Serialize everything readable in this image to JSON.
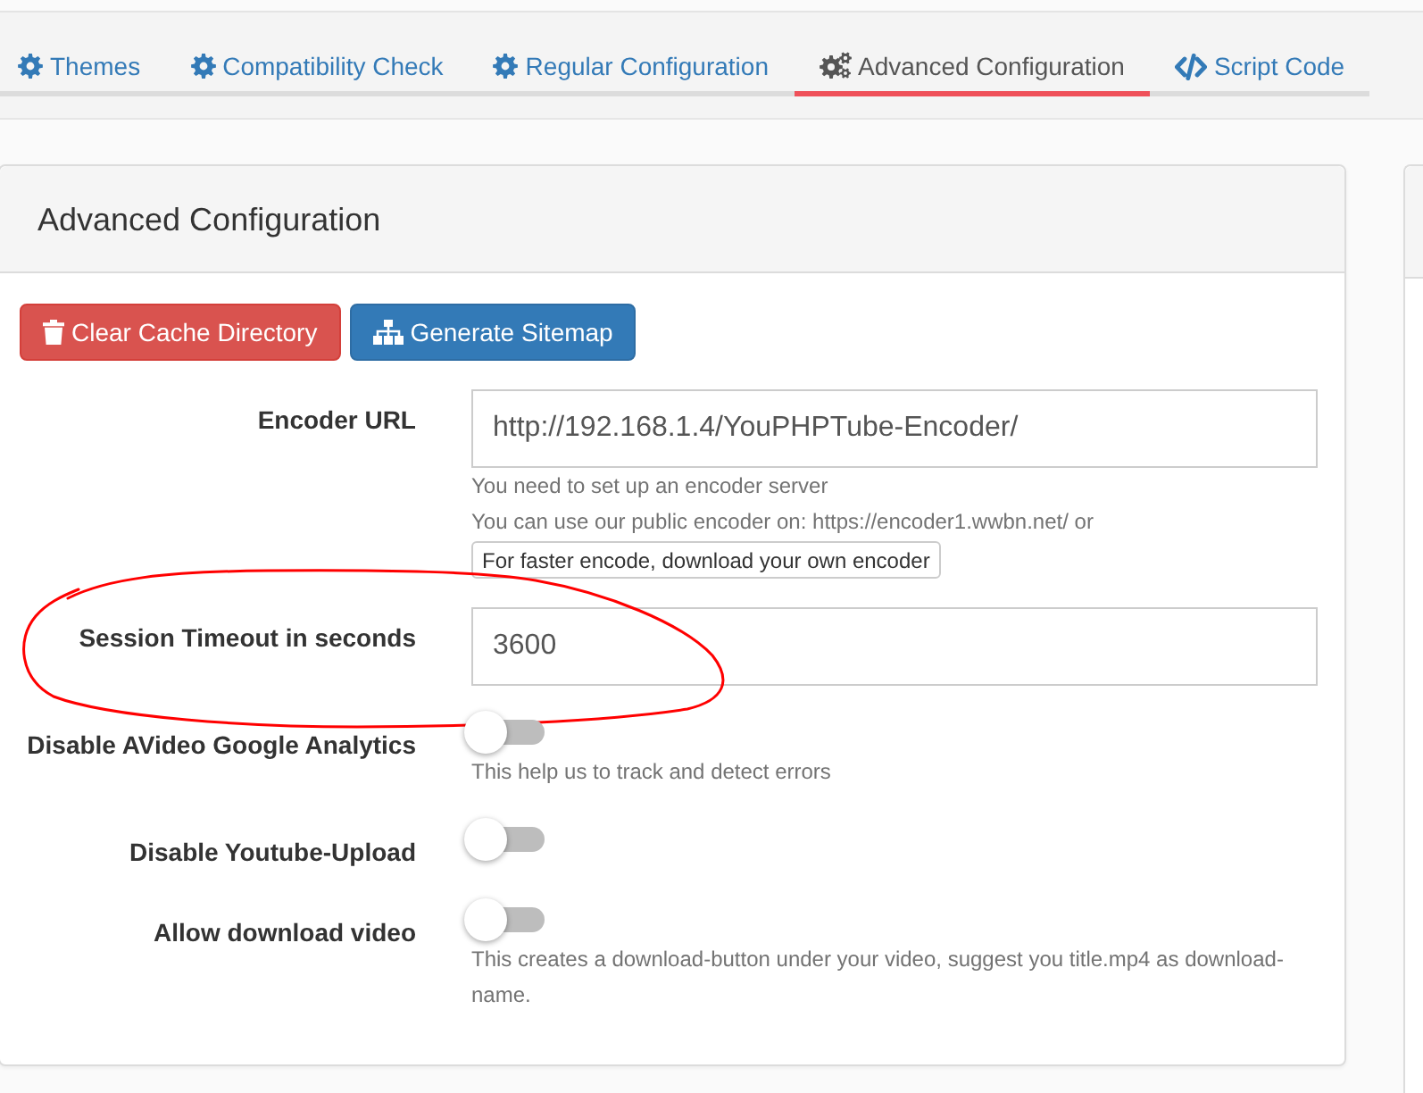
{
  "tabs": [
    {
      "label": "Themes",
      "kind": "gear",
      "selected": false
    },
    {
      "label": "Compatibility Check",
      "kind": "gear",
      "selected": false
    },
    {
      "label": "Regular Configuration",
      "kind": "gear",
      "selected": false
    },
    {
      "label": "Advanced Configuration",
      "kind": "cogs",
      "selected": true
    },
    {
      "label": "Script Code",
      "kind": "code",
      "selected": false
    }
  ],
  "panel": {
    "title": "Advanced Configuration",
    "buttons": [
      {
        "label": "Clear Cache Directory",
        "kind": "danger"
      },
      {
        "label": "Generate Sitemap",
        "kind": "primary"
      }
    ]
  },
  "fields": [
    {
      "kind": "text",
      "label": "Encoder URL",
      "value": "http://192.168.1.4/YouPHPTube-Encoder/",
      "circled": false,
      "help": [
        "You need to set up an encoder server",
        "You can use our public encoder on: https://encoder1.wwbn.net/ or"
      ],
      "help_button": "For faster encode, download your own encoder"
    },
    {
      "kind": "text",
      "label": "Session Timeout in seconds",
      "value": "3600",
      "circled": true
    },
    {
      "kind": "toggle",
      "label": "Disable AVideo Google Analytics",
      "on": false,
      "circled": false,
      "help": [
        "This help us to track and detect errors"
      ]
    },
    {
      "kind": "toggle",
      "label": "Disable Youtube-Upload",
      "on": false,
      "circled": false
    },
    {
      "kind": "toggle",
      "label": "Allow download video",
      "on": false,
      "circled": false,
      "help": [
        "This creates a download-button under your video, suggest you title.mp4 as download-name."
      ]
    }
  ]
}
